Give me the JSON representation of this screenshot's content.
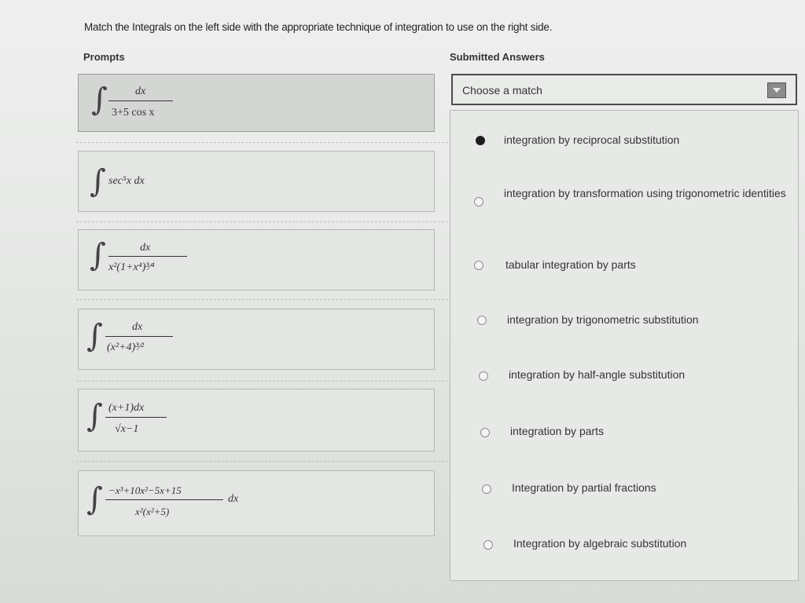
{
  "instruction": "Match the Integrals on the left side with the appropriate technique of integration to use on the right side.",
  "headers": {
    "prompts": "Prompts",
    "answers": "Submitted Answers"
  },
  "prompts": [
    {
      "num": "dx",
      "den": "3+5 cos x"
    },
    {
      "expr": "sec⁵x dx"
    },
    {
      "num": "dx",
      "den": "x²(1+x⁴)³⁄⁴"
    },
    {
      "num": "dx",
      "den": "(x²+4)³⁄²"
    },
    {
      "num": "(x+1)dx",
      "den": "√x−1"
    },
    {
      "num": "−x³+10x²−5x+15",
      "den": "x²(x²+5)",
      "tail": "dx"
    }
  ],
  "dropdown": {
    "placeholder": "Choose a match"
  },
  "options": [
    {
      "label": "integration by reciprocal substitution",
      "selected": true
    },
    {
      "label": "integration by transformation using trigonometric identities",
      "selected": false
    },
    {
      "label": "tabular integration by parts",
      "selected": false
    },
    {
      "label": "integration by trigonometric substitution",
      "selected": false
    },
    {
      "label": "integration by half-angle substitution",
      "selected": false
    },
    {
      "label": "integration by parts",
      "selected": false
    },
    {
      "label": "Integration by partial fractions",
      "selected": false
    },
    {
      "label": "Integration by algebraic substitution",
      "selected": false
    }
  ]
}
